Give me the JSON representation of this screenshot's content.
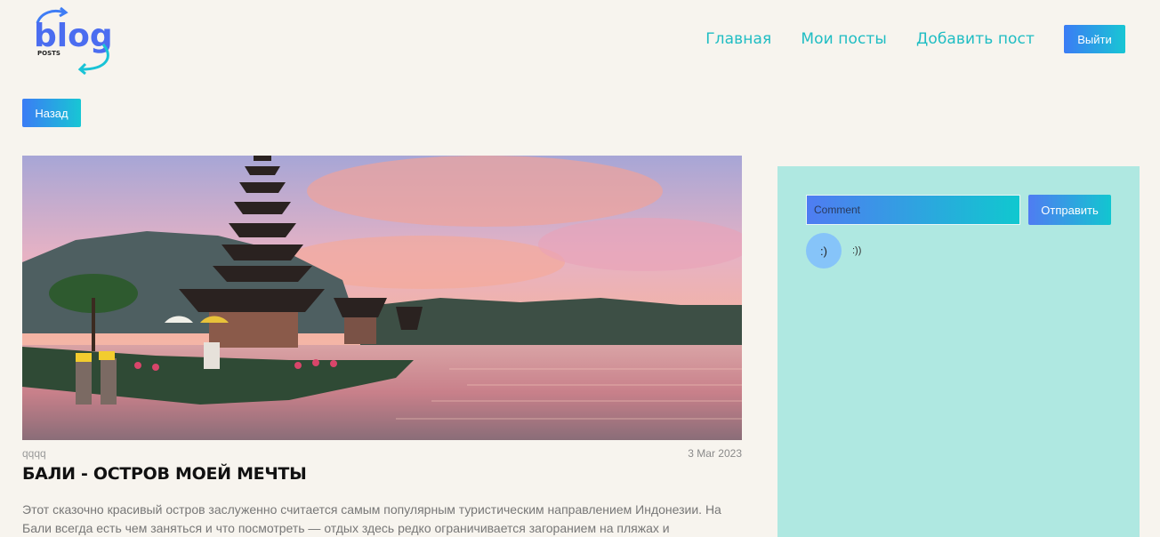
{
  "header": {
    "logo_word": "blog",
    "logo_sub": "POSTS",
    "nav": [
      {
        "label": "Главная"
      },
      {
        "label": "Мои посты"
      },
      {
        "label": "Добавить пост"
      }
    ],
    "logout_label": "Выйти"
  },
  "back_label": "Назад",
  "post": {
    "author": "qqqq",
    "date": "3 Мar 2023",
    "title": "БАЛИ - ОСТРОВ МОЕЙ МЕЧТЫ",
    "body": "Этот сказочно красивый остров заслуженно считается самым популярным туристическим направлением Индонезии. На Бали всегда есть чем заняться и что посмотреть — отдых здесь редко ограничивается загоранием на пляжах и"
  },
  "comments_panel": {
    "input_placeholder": "Comment",
    "send_label": "Отправить",
    "comments": [
      {
        "avatar": ":)",
        "text": ":))"
      }
    ]
  },
  "colors": {
    "accent": "#1fbdc3",
    "button_gradient_start": "#3b7cf5",
    "button_gradient_end": "#18c6d4",
    "panel_bg": "#afe8e1",
    "page_bg": "#f7f4ee"
  }
}
